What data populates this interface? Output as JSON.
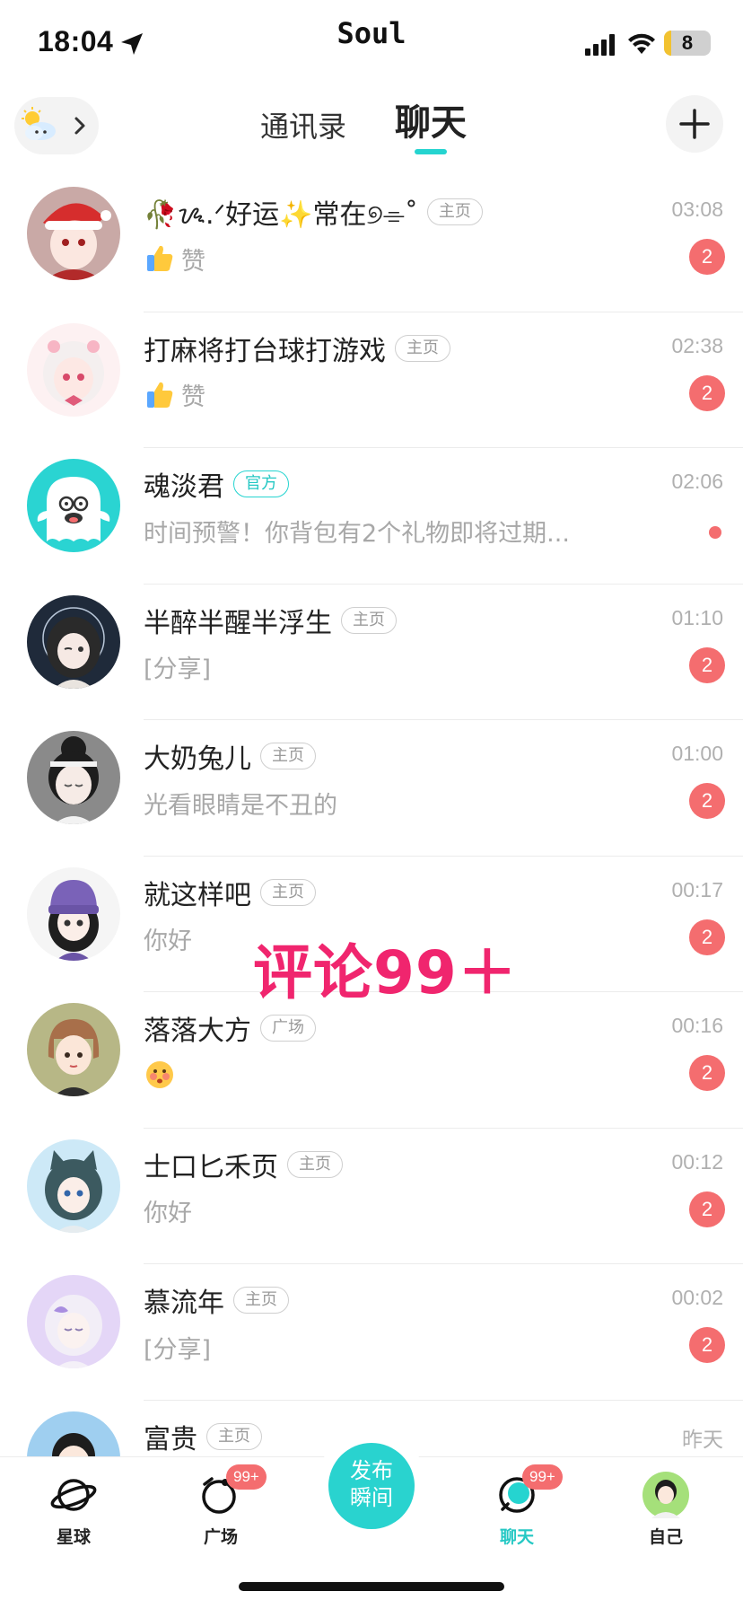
{
  "status_bar": {
    "time": "18:04",
    "app_name": "Soul",
    "battery": "8",
    "battery_level_percent": 8
  },
  "header": {
    "tabs": [
      {
        "label": "通讯录",
        "active": false
      },
      {
        "label": "聊天",
        "active": true
      }
    ],
    "weather_icon": "sun-cloud-icon",
    "add_icon": "plus-icon",
    "accent_color": "#25d4d0"
  },
  "chats": [
    {
      "name": "🥀ᝰ.ᐟ好运✨常在୭⌯˚",
      "tag": "主页",
      "time": "03:08",
      "preview": "赞",
      "preview_icon": "thumbs-up-icon",
      "badge": "2"
    },
    {
      "name": "打麻将打台球打游戏",
      "tag": "主页",
      "time": "02:38",
      "preview": "赞",
      "preview_icon": "thumbs-up-icon",
      "badge": "2"
    },
    {
      "name": "魂淡君",
      "tag": "官方",
      "time": "02:06",
      "preview": "时间预警！你背包有2个礼物即将过期...",
      "unread_dot": true
    },
    {
      "name": "半醉半醒半浮生",
      "tag": "主页",
      "time": "01:10",
      "preview": "[分享]",
      "badge": "2"
    },
    {
      "name": "大奶兔儿",
      "tag": "主页",
      "time": "01:00",
      "preview": "光看眼睛是不丑的",
      "badge": "2"
    },
    {
      "name": "就这样吧",
      "tag": "主页",
      "time": "00:17",
      "preview": "你好",
      "badge": "2"
    },
    {
      "name": "落落大方",
      "tag": "广场",
      "time": "00:16",
      "preview": "",
      "preview_icon": "blushing-face-icon",
      "badge": "2"
    },
    {
      "name": "士口匕禾页",
      "tag": "主页",
      "time": "00:12",
      "preview": "你好",
      "badge": "2"
    },
    {
      "name": "慕流年",
      "tag": "主页",
      "time": "00:02",
      "preview": "[分享]",
      "badge": "2"
    },
    {
      "name": "富贵",
      "tag": "主页",
      "time": "昨天",
      "preview": ""
    }
  ],
  "overlay": {
    "text": "评论99＋",
    "color": "#f0256e"
  },
  "tabbar": {
    "items": [
      {
        "label": "星球",
        "icon": "planet-icon"
      },
      {
        "label": "广场",
        "icon": "square-icon",
        "count": "99+"
      },
      {
        "label": "发布\n瞬间",
        "icon": "publish-button"
      },
      {
        "label": "聊天",
        "icon": "chat-icon",
        "count": "99+",
        "active": true
      },
      {
        "label": "自己",
        "icon": "self-avatar-icon"
      }
    ],
    "publish_line1": "发布",
    "publish_line2": "瞬间"
  }
}
